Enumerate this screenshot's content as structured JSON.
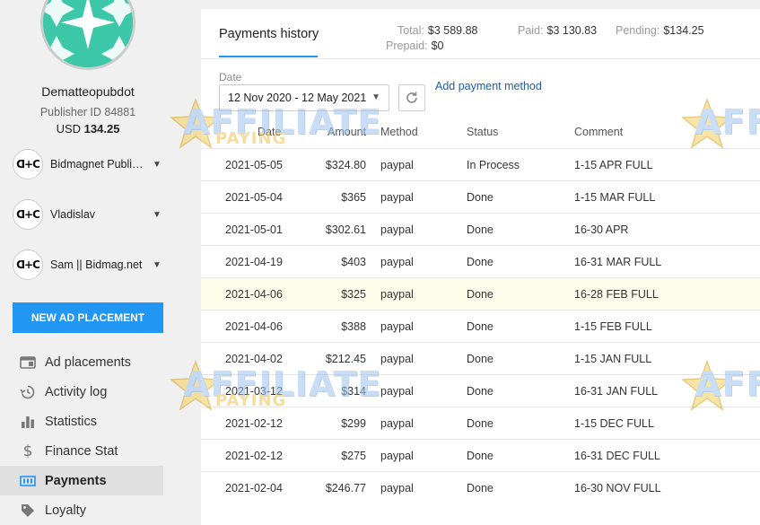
{
  "user": {
    "name": "Dematteopubdot",
    "publisher_id": "Publisher ID 84881",
    "balance_currency": "USD",
    "balance_amount": "134.25"
  },
  "accounts": [
    {
      "logo": "ᗡ+C",
      "name": "Bidmagnet Publisher"
    },
    {
      "logo": "ᗡ+C",
      "name": "Vladislav"
    },
    {
      "logo": "ᗡ+C",
      "name": "Sam || Bidmag.net"
    }
  ],
  "sidebar": {
    "new_ad_label": "NEW AD PLACEMENT",
    "nav": [
      {
        "label": "Ad placements",
        "icon": "ad-placements-icon"
      },
      {
        "label": "Activity log",
        "icon": "history-icon"
      },
      {
        "label": "Statistics",
        "icon": "bar-chart-icon"
      },
      {
        "label": "Finance Stat",
        "icon": "dollar-icon"
      },
      {
        "label": "Payments",
        "icon": "payments-icon",
        "active": true
      },
      {
        "label": "Loyalty",
        "icon": "loyalty-icon"
      }
    ]
  },
  "header": {
    "title": "Payments history",
    "total_label": "Total:",
    "total_value": "$3 589.88",
    "prepaid_label": "Prepaid:",
    "prepaid_value": "$0",
    "paid_label": "Paid:",
    "paid_value": "$3 130.83",
    "pending_label": "Pending:",
    "pending_value": "$134.25"
  },
  "filters": {
    "date_label": "Date",
    "date_range": "12 Nov 2020 - 12 May 2021",
    "add_method_label": "Add payment method"
  },
  "table": {
    "columns": [
      "Date",
      "Amount",
      "Method",
      "Status",
      "Comment"
    ],
    "rows": [
      [
        "2021-05-05",
        "$324.80",
        "paypal",
        "In Process",
        "1-15 APR FULL"
      ],
      [
        "2021-05-04",
        "$365",
        "paypal",
        "Done",
        "1-15 MAR FULL"
      ],
      [
        "2021-05-01",
        "$302.61",
        "paypal",
        "Done",
        "16-30 APR"
      ],
      [
        "2021-04-19",
        "$403",
        "paypal",
        "Done",
        "16-31 MAR FULL"
      ],
      [
        "2021-04-06",
        "$325",
        "paypal",
        "Done",
        "16-28 FEB FULL"
      ],
      [
        "2021-04-06",
        "$388",
        "paypal",
        "Done",
        "1-15 FEB FULL"
      ],
      [
        "2021-04-02",
        "$212.45",
        "paypal",
        "Done",
        "1-15 JAN FULL"
      ],
      [
        "2021-03-12",
        "$314",
        "paypal",
        "Done",
        "16-31 JAN FULL"
      ],
      [
        "2021-02-12",
        "$299",
        "paypal",
        "Done",
        "1-15 DEC FULL"
      ],
      [
        "2021-02-12",
        "$275",
        "paypal",
        "Done",
        "16-31 DEC FULL"
      ],
      [
        "2021-02-04",
        "$246.77",
        "paypal",
        "Done",
        "16-30 NOV FULL"
      ]
    ]
  },
  "watermark": {
    "big": "AFFILIATE",
    "small": "PAYING"
  },
  "colors": {
    "accent": "#2196f3",
    "link": "#1f5fa8",
    "highlight_row": "#fcfcea",
    "avatar": "#3cc7a8"
  }
}
